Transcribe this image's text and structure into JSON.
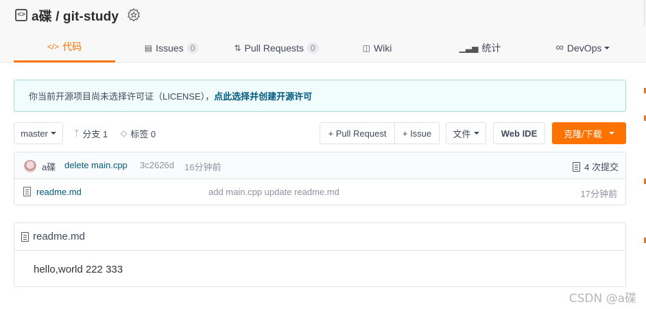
{
  "repo": {
    "title": "a碟 / git-study"
  },
  "tabs": [
    {
      "label": "代码",
      "icon": "code-icon"
    },
    {
      "label": "Issues",
      "count": "0",
      "icon": "issues-icon"
    },
    {
      "label": "Pull Requests",
      "count": "0",
      "icon": "pull-request-icon"
    },
    {
      "label": "Wiki",
      "icon": "wiki-icon"
    },
    {
      "label": "统计",
      "icon": "stats-icon"
    },
    {
      "label": "DevOps",
      "icon": "devops-icon"
    }
  ],
  "notice": {
    "text": "你当前开源项目尚未选择许可证（LICENSE），",
    "link": "点此选择并创建开源许可"
  },
  "toolbar": {
    "branch": "master",
    "branches_label": "分支 1",
    "tags_label": "标签 0",
    "pull_request": "+ Pull Request",
    "issue": "+ Issue",
    "files": "文件",
    "web_ide": "Web IDE",
    "clone": "克隆/下载"
  },
  "commit": {
    "author": "a碟",
    "message": "delete main.cpp",
    "hash": "3c2626d",
    "time": "16分钟前",
    "count": "4 次提交"
  },
  "files": [
    {
      "name": "readme.md",
      "commit": "add main.cpp update readme.md",
      "time": "17分钟前"
    }
  ],
  "readme": {
    "title": "readme.md",
    "content": "hello,world 222 333"
  },
  "watermark": "CSDN @a碟",
  "colors": {
    "accent": "#fe7300",
    "link": "#005980",
    "notice_bg": "#f1fcfc"
  }
}
